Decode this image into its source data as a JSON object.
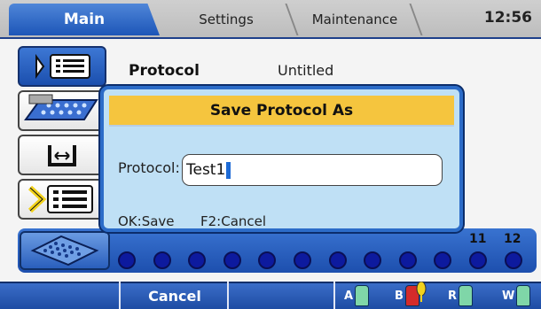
{
  "tabs": [
    {
      "label": "Main"
    },
    {
      "label": "Settings"
    },
    {
      "label": "Maintenance"
    }
  ],
  "clock": "12:56",
  "content": {
    "protocol_label": "Protocol",
    "protocol_value": "Untitled"
  },
  "left_icons": [
    "protocol-list-icon",
    "dispense-plate-icon",
    "bath-temperature-icon",
    "step-list-icon",
    "microplate-icon"
  ],
  "plate": {
    "column_numbers": [
      "11",
      "12"
    ],
    "well_count": 12,
    "well_color": "#0d1a9e"
  },
  "dialog": {
    "title": "Save Protocol As",
    "field_label": "Protocol:",
    "field_value": "Test1",
    "hint_ok": "OK:Save",
    "hint_cancel": "F2:Cancel"
  },
  "bottom": {
    "cancel_label": "Cancel",
    "bottles": [
      {
        "letter": "A",
        "color": "#7fd6a8",
        "status": "ok"
      },
      {
        "letter": "B",
        "color": "#d42b2b",
        "status": "warning"
      },
      {
        "letter": "R",
        "color": "#7fd6a8",
        "status": "ok"
      },
      {
        "letter": "W",
        "color": "#7fd6a8",
        "status": "ok"
      }
    ]
  },
  "colors": {
    "accent_blue": "#1d56b8",
    "dialog_title_bg": "#f5c53e",
    "dialog_bg": "#bfe0f5"
  }
}
